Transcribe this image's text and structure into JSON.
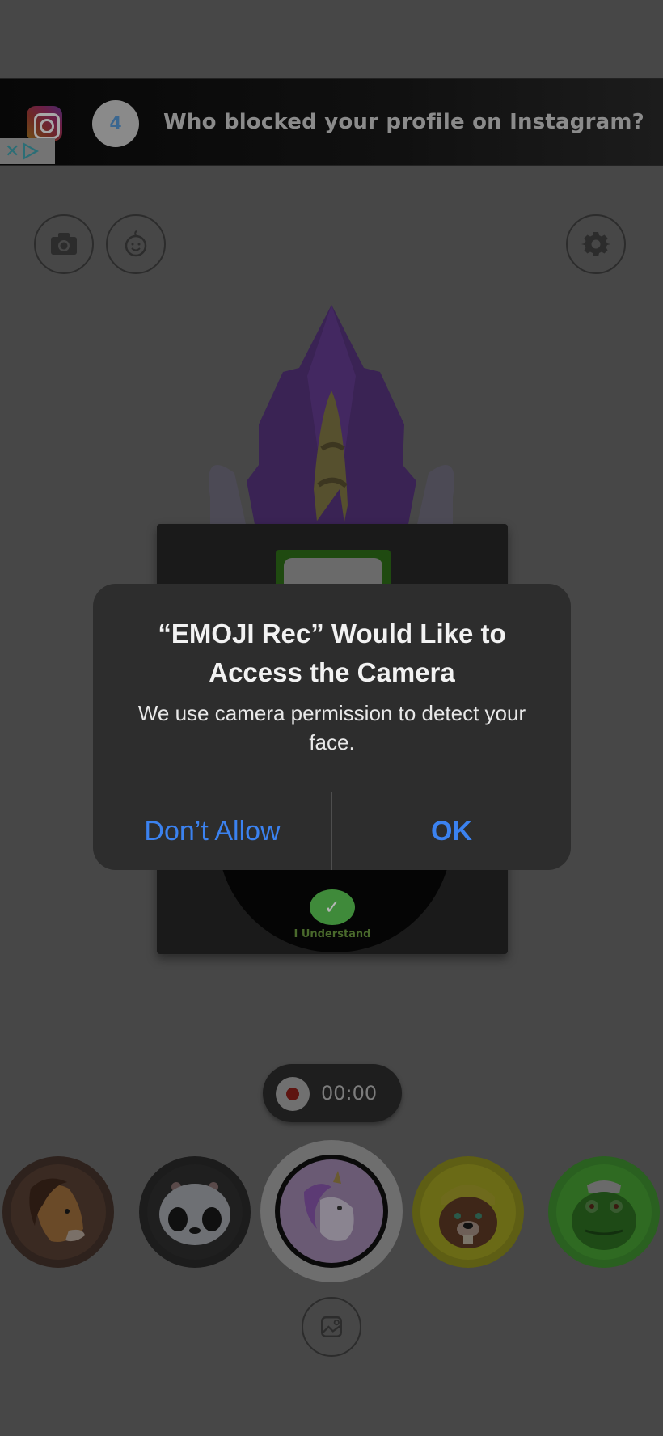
{
  "ad": {
    "icon": "instagram-icon",
    "badge_number": "4",
    "headline": "Who blocked your profile on Instagram?",
    "adchoices_close": "✕",
    "adchoices_icon": "adchoices-play-icon"
  },
  "toolbar": {
    "left_buttons": [
      {
        "icon": "camera-icon"
      },
      {
        "icon": "baby-face-icon"
      }
    ],
    "right_button": {
      "icon": "gear-icon"
    }
  },
  "onboarding_card": {
    "confirm_label": "I Understand",
    "confirm_icon": "checkmark-icon"
  },
  "recorder": {
    "timer": "00:00",
    "record_icon": "record-dot-icon"
  },
  "emojis": [
    {
      "name": "horse",
      "selected": false,
      "color": "#3a2a22"
    },
    {
      "name": "panda",
      "selected": false,
      "color": "#1c1c1c"
    },
    {
      "name": "unicorn",
      "selected": true,
      "color": "#6a5a74"
    },
    {
      "name": "beaver",
      "selected": false,
      "color": "#6a6a16"
    },
    {
      "name": "dinosaur",
      "selected": false,
      "color": "#2f6a22"
    }
  ],
  "gallery": {
    "icon": "gallery-image-icon"
  },
  "alert": {
    "title": "“EMOJI Rec” Would Like to Access the Camera",
    "message": "We use camera permission to detect your face.",
    "buttons": {
      "deny": "Don’t Allow",
      "ok": "OK"
    },
    "button_color": "#3b82f0"
  }
}
